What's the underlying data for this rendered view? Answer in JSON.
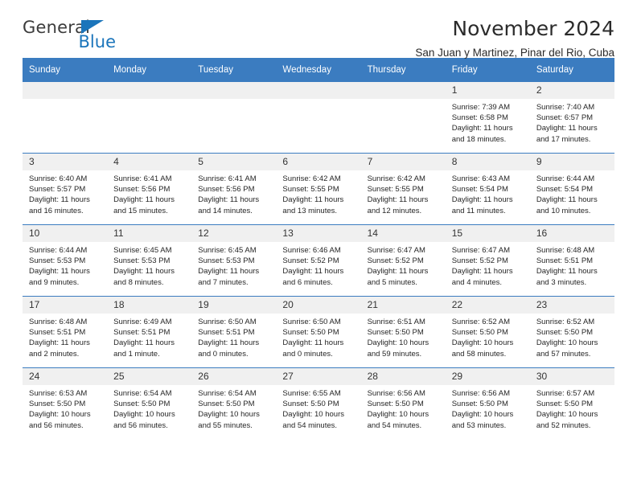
{
  "logo": {
    "part1": "General",
    "part2": "Blue",
    "triangle_color": "#1b75bb"
  },
  "header": {
    "title": "November 2024",
    "subtitle": "San Juan y Martinez, Pinar del Rio, Cuba"
  },
  "colors": {
    "header_blue": "#3b7cc0",
    "daynum_background": "#f0f0f0",
    "text": "#262626"
  },
  "weekday_headers": [
    "Sunday",
    "Monday",
    "Tuesday",
    "Wednesday",
    "Thursday",
    "Friday",
    "Saturday"
  ],
  "weeks": [
    [
      {
        "day": "",
        "sunrise": "",
        "sunset": "",
        "daylight": "",
        "empty": true
      },
      {
        "day": "",
        "sunrise": "",
        "sunset": "",
        "daylight": "",
        "empty": true
      },
      {
        "day": "",
        "sunrise": "",
        "sunset": "",
        "daylight": "",
        "empty": true
      },
      {
        "day": "",
        "sunrise": "",
        "sunset": "",
        "daylight": "",
        "empty": true
      },
      {
        "day": "",
        "sunrise": "",
        "sunset": "",
        "daylight": "",
        "empty": true
      },
      {
        "day": "1",
        "sunrise": "Sunrise: 7:39 AM",
        "sunset": "Sunset: 6:58 PM",
        "daylight": "Daylight: 11 hours and 18 minutes.",
        "empty": false
      },
      {
        "day": "2",
        "sunrise": "Sunrise: 7:40 AM",
        "sunset": "Sunset: 6:57 PM",
        "daylight": "Daylight: 11 hours and 17 minutes.",
        "empty": false
      }
    ],
    [
      {
        "day": "3",
        "sunrise": "Sunrise: 6:40 AM",
        "sunset": "Sunset: 5:57 PM",
        "daylight": "Daylight: 11 hours and 16 minutes.",
        "empty": false
      },
      {
        "day": "4",
        "sunrise": "Sunrise: 6:41 AM",
        "sunset": "Sunset: 5:56 PM",
        "daylight": "Daylight: 11 hours and 15 minutes.",
        "empty": false
      },
      {
        "day": "5",
        "sunrise": "Sunrise: 6:41 AM",
        "sunset": "Sunset: 5:56 PM",
        "daylight": "Daylight: 11 hours and 14 minutes.",
        "empty": false
      },
      {
        "day": "6",
        "sunrise": "Sunrise: 6:42 AM",
        "sunset": "Sunset: 5:55 PM",
        "daylight": "Daylight: 11 hours and 13 minutes.",
        "empty": false
      },
      {
        "day": "7",
        "sunrise": "Sunrise: 6:42 AM",
        "sunset": "Sunset: 5:55 PM",
        "daylight": "Daylight: 11 hours and 12 minutes.",
        "empty": false
      },
      {
        "day": "8",
        "sunrise": "Sunrise: 6:43 AM",
        "sunset": "Sunset: 5:54 PM",
        "daylight": "Daylight: 11 hours and 11 minutes.",
        "empty": false
      },
      {
        "day": "9",
        "sunrise": "Sunrise: 6:44 AM",
        "sunset": "Sunset: 5:54 PM",
        "daylight": "Daylight: 11 hours and 10 minutes.",
        "empty": false
      }
    ],
    [
      {
        "day": "10",
        "sunrise": "Sunrise: 6:44 AM",
        "sunset": "Sunset: 5:53 PM",
        "daylight": "Daylight: 11 hours and 9 minutes.",
        "empty": false
      },
      {
        "day": "11",
        "sunrise": "Sunrise: 6:45 AM",
        "sunset": "Sunset: 5:53 PM",
        "daylight": "Daylight: 11 hours and 8 minutes.",
        "empty": false
      },
      {
        "day": "12",
        "sunrise": "Sunrise: 6:45 AM",
        "sunset": "Sunset: 5:53 PM",
        "daylight": "Daylight: 11 hours and 7 minutes.",
        "empty": false
      },
      {
        "day": "13",
        "sunrise": "Sunrise: 6:46 AM",
        "sunset": "Sunset: 5:52 PM",
        "daylight": "Daylight: 11 hours and 6 minutes.",
        "empty": false
      },
      {
        "day": "14",
        "sunrise": "Sunrise: 6:47 AM",
        "sunset": "Sunset: 5:52 PM",
        "daylight": "Daylight: 11 hours and 5 minutes.",
        "empty": false
      },
      {
        "day": "15",
        "sunrise": "Sunrise: 6:47 AM",
        "sunset": "Sunset: 5:52 PM",
        "daylight": "Daylight: 11 hours and 4 minutes.",
        "empty": false
      },
      {
        "day": "16",
        "sunrise": "Sunrise: 6:48 AM",
        "sunset": "Sunset: 5:51 PM",
        "daylight": "Daylight: 11 hours and 3 minutes.",
        "empty": false
      }
    ],
    [
      {
        "day": "17",
        "sunrise": "Sunrise: 6:48 AM",
        "sunset": "Sunset: 5:51 PM",
        "daylight": "Daylight: 11 hours and 2 minutes.",
        "empty": false
      },
      {
        "day": "18",
        "sunrise": "Sunrise: 6:49 AM",
        "sunset": "Sunset: 5:51 PM",
        "daylight": "Daylight: 11 hours and 1 minute.",
        "empty": false
      },
      {
        "day": "19",
        "sunrise": "Sunrise: 6:50 AM",
        "sunset": "Sunset: 5:51 PM",
        "daylight": "Daylight: 11 hours and 0 minutes.",
        "empty": false
      },
      {
        "day": "20",
        "sunrise": "Sunrise: 6:50 AM",
        "sunset": "Sunset: 5:50 PM",
        "daylight": "Daylight: 11 hours and 0 minutes.",
        "empty": false
      },
      {
        "day": "21",
        "sunrise": "Sunrise: 6:51 AM",
        "sunset": "Sunset: 5:50 PM",
        "daylight": "Daylight: 10 hours and 59 minutes.",
        "empty": false
      },
      {
        "day": "22",
        "sunrise": "Sunrise: 6:52 AM",
        "sunset": "Sunset: 5:50 PM",
        "daylight": "Daylight: 10 hours and 58 minutes.",
        "empty": false
      },
      {
        "day": "23",
        "sunrise": "Sunrise: 6:52 AM",
        "sunset": "Sunset: 5:50 PM",
        "daylight": "Daylight: 10 hours and 57 minutes.",
        "empty": false
      }
    ],
    [
      {
        "day": "24",
        "sunrise": "Sunrise: 6:53 AM",
        "sunset": "Sunset: 5:50 PM",
        "daylight": "Daylight: 10 hours and 56 minutes.",
        "empty": false
      },
      {
        "day": "25",
        "sunrise": "Sunrise: 6:54 AM",
        "sunset": "Sunset: 5:50 PM",
        "daylight": "Daylight: 10 hours and 56 minutes.",
        "empty": false
      },
      {
        "day": "26",
        "sunrise": "Sunrise: 6:54 AM",
        "sunset": "Sunset: 5:50 PM",
        "daylight": "Daylight: 10 hours and 55 minutes.",
        "empty": false
      },
      {
        "day": "27",
        "sunrise": "Sunrise: 6:55 AM",
        "sunset": "Sunset: 5:50 PM",
        "daylight": "Daylight: 10 hours and 54 minutes.",
        "empty": false
      },
      {
        "day": "28",
        "sunrise": "Sunrise: 6:56 AM",
        "sunset": "Sunset: 5:50 PM",
        "daylight": "Daylight: 10 hours and 54 minutes.",
        "empty": false
      },
      {
        "day": "29",
        "sunrise": "Sunrise: 6:56 AM",
        "sunset": "Sunset: 5:50 PM",
        "daylight": "Daylight: 10 hours and 53 minutes.",
        "empty": false
      },
      {
        "day": "30",
        "sunrise": "Sunrise: 6:57 AM",
        "sunset": "Sunset: 5:50 PM",
        "daylight": "Daylight: 10 hours and 52 minutes.",
        "empty": false
      }
    ]
  ]
}
